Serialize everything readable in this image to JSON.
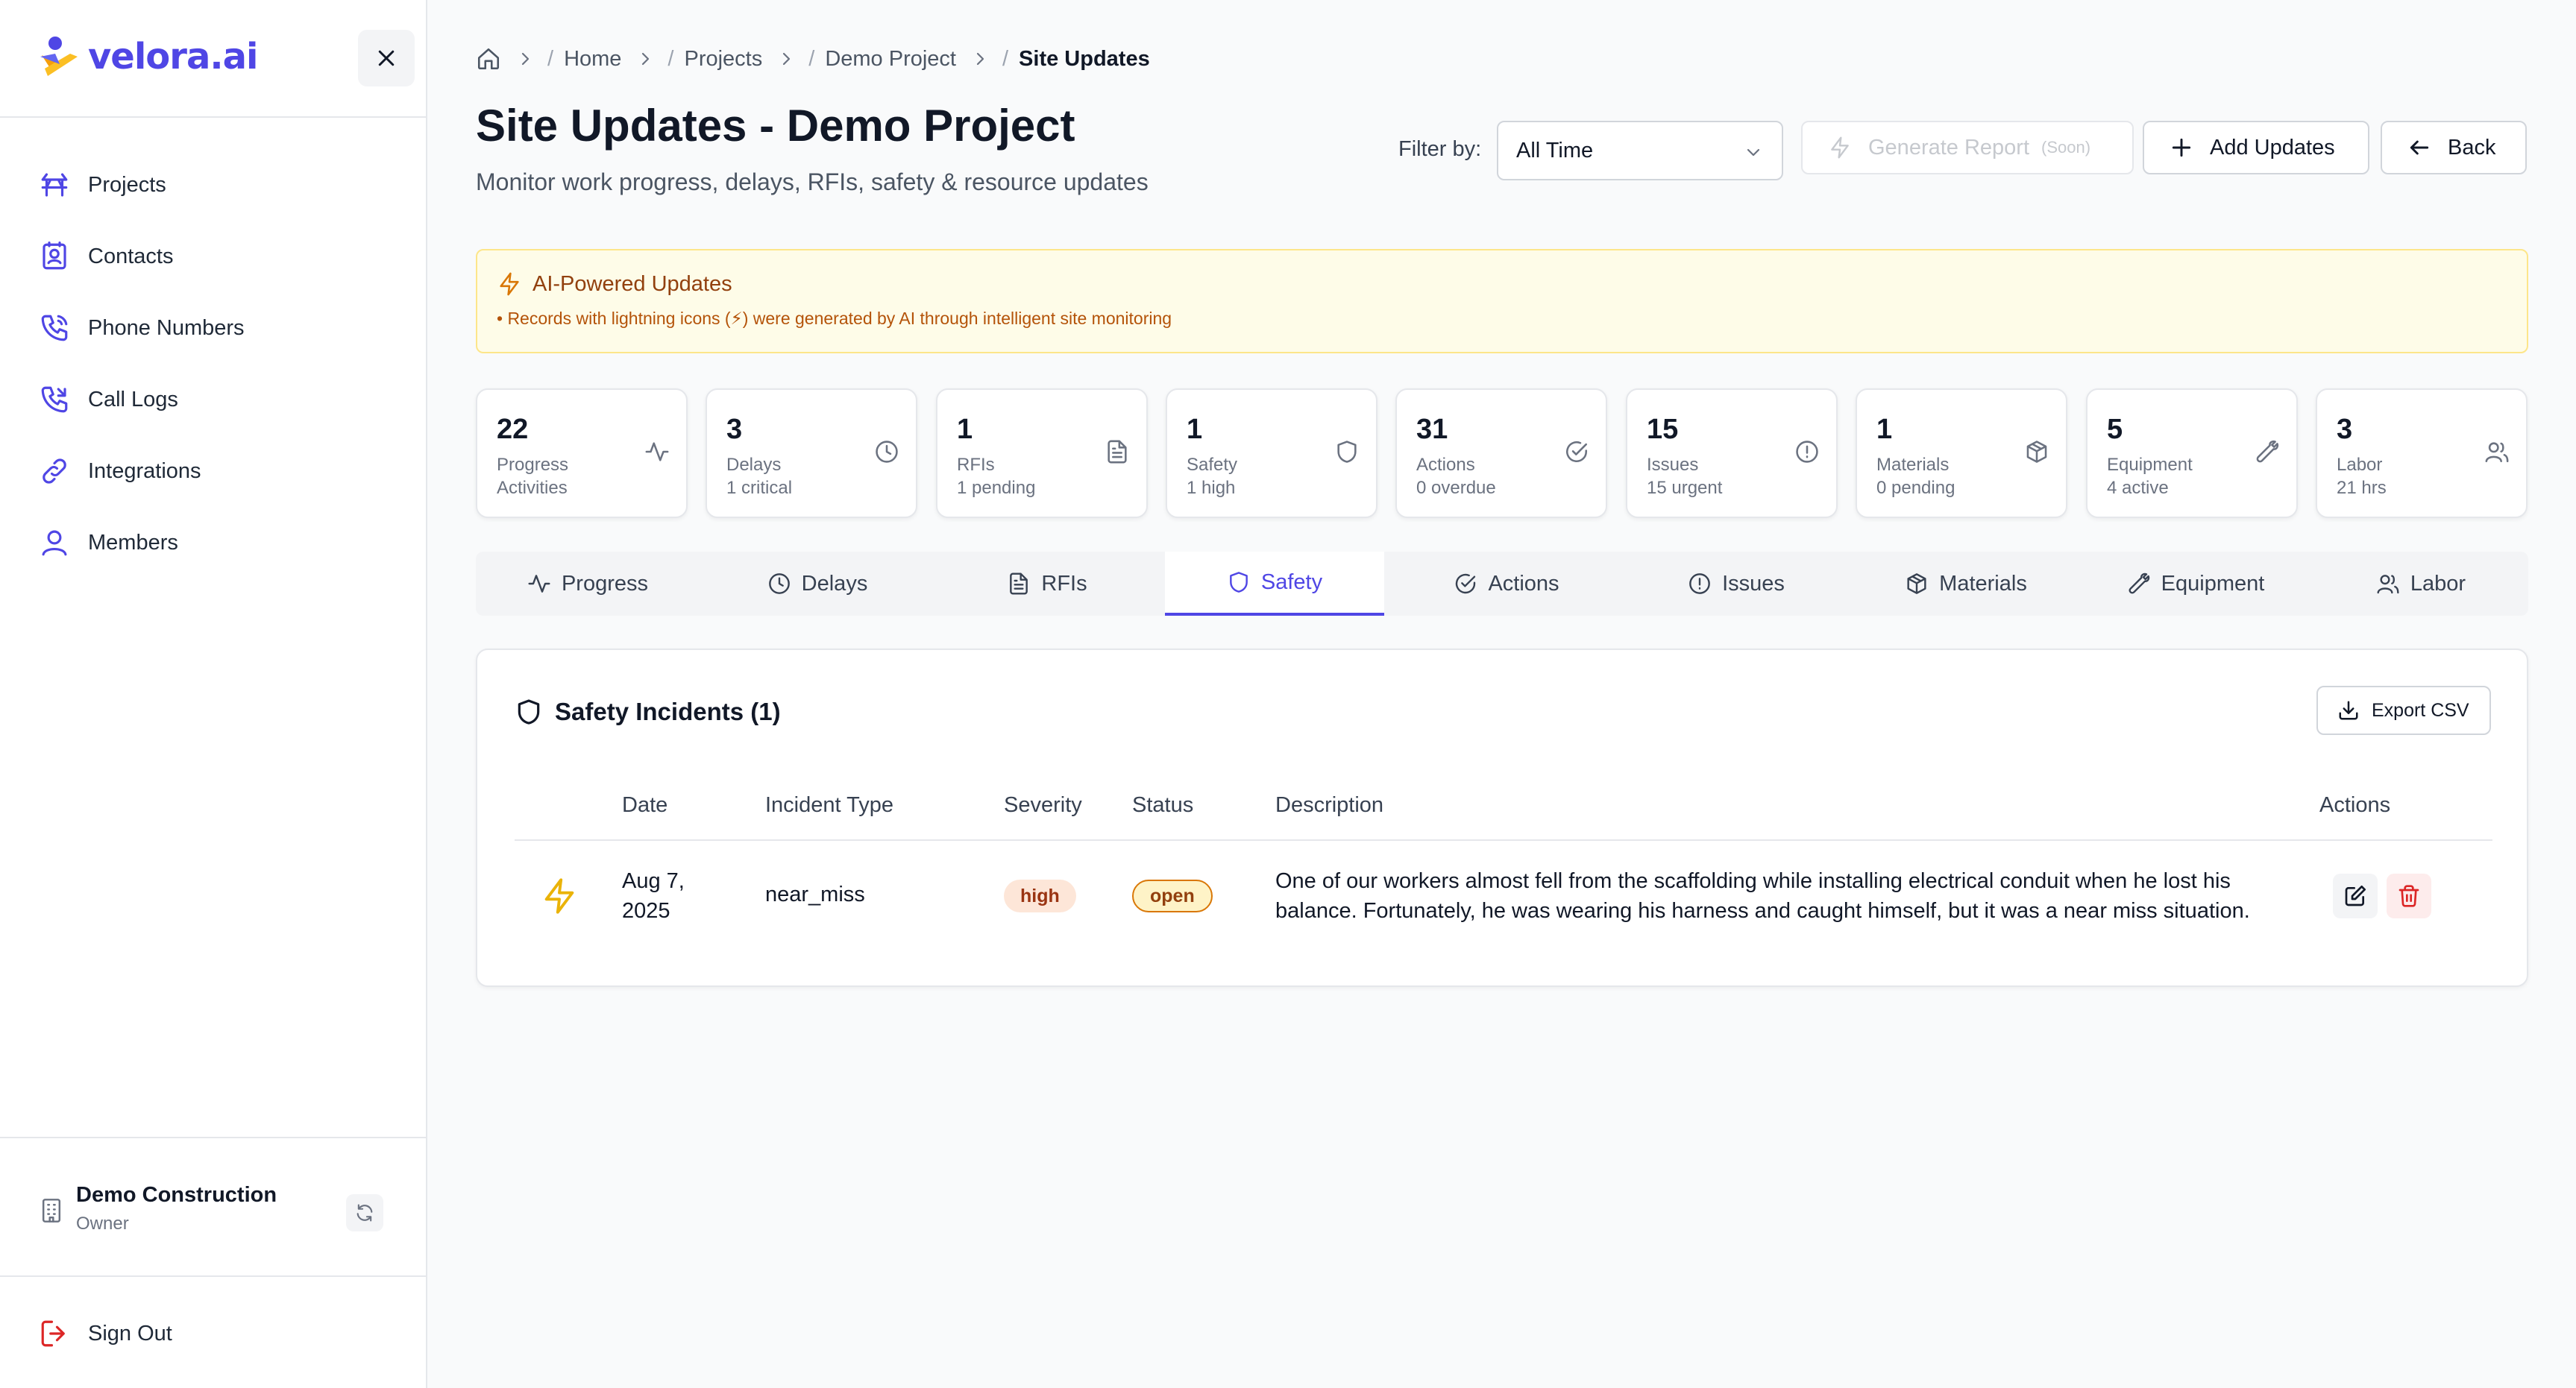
{
  "app": {
    "name": "velora.ai"
  },
  "sidebar": {
    "items": [
      {
        "label": "Projects",
        "icon": "projects-icon"
      },
      {
        "label": "Contacts",
        "icon": "contacts-icon"
      },
      {
        "label": "Phone Numbers",
        "icon": "phone-icon"
      },
      {
        "label": "Call Logs",
        "icon": "phone-call-icon"
      },
      {
        "label": "Integrations",
        "icon": "link-icon"
      },
      {
        "label": "Members",
        "icon": "user-icon"
      }
    ],
    "org": {
      "name": "Demo Construction",
      "role": "Owner"
    },
    "signout_label": "Sign Out"
  },
  "breadcrumb": {
    "items": [
      "Home",
      "Projects",
      "Demo Project"
    ],
    "current": "Site Updates"
  },
  "header": {
    "title": "Site Updates - Demo Project",
    "subtitle": "Monitor work progress, delays, RFIs, safety & resource updates",
    "filter_label": "Filter by:",
    "filter_value": "All Time",
    "generate_label": "Generate Report",
    "generate_soon": "(Soon)",
    "add_label": "Add Updates",
    "back_label": "Back"
  },
  "ai_banner": {
    "title": "AI-Powered Updates",
    "note": "• Records with lightning icons (⚡) were generated by AI through intelligent site monitoring"
  },
  "stats": [
    {
      "value": "22",
      "label": "Progress Activities",
      "sub": "",
      "icon": "activity-icon"
    },
    {
      "value": "3",
      "label": "Delays",
      "sub": "1 critical",
      "icon": "clock-icon"
    },
    {
      "value": "1",
      "label": "RFIs",
      "sub": "1 pending",
      "icon": "document-icon"
    },
    {
      "value": "1",
      "label": "Safety",
      "sub": "1 high",
      "icon": "shield-icon"
    },
    {
      "value": "31",
      "label": "Actions",
      "sub": "0 overdue",
      "icon": "check-circle-icon"
    },
    {
      "value": "15",
      "label": "Issues",
      "sub": "15 urgent",
      "icon": "alert-circle-icon"
    },
    {
      "value": "1",
      "label": "Materials",
      "sub": "0 pending",
      "icon": "package-icon"
    },
    {
      "value": "5",
      "label": "Equipment",
      "sub": "4 active",
      "icon": "wrench-icon"
    },
    {
      "value": "3",
      "label": "Labor",
      "sub": "21 hrs",
      "icon": "users-icon"
    }
  ],
  "tabs": [
    {
      "label": "Progress",
      "icon": "activity-icon",
      "active": false
    },
    {
      "label": "Delays",
      "icon": "clock-icon",
      "active": false
    },
    {
      "label": "RFIs",
      "icon": "document-icon",
      "active": false
    },
    {
      "label": "Safety",
      "icon": "shield-icon",
      "active": true
    },
    {
      "label": "Actions",
      "icon": "check-circle-icon",
      "active": false
    },
    {
      "label": "Issues",
      "icon": "alert-circle-icon",
      "active": false
    },
    {
      "label": "Materials",
      "icon": "package-icon",
      "active": false
    },
    {
      "label": "Equipment",
      "icon": "wrench-icon",
      "active": false
    },
    {
      "label": "Labor",
      "icon": "users-icon",
      "active": false
    }
  ],
  "table": {
    "title": "Safety Incidents (1)",
    "export_label": "Export CSV",
    "columns": [
      "Date",
      "Incident Type",
      "Severity",
      "Status",
      "Description",
      "Actions"
    ],
    "rows": [
      {
        "ai_generated": true,
        "date": "Aug 7, 2025",
        "type": "near_miss",
        "severity": "high",
        "status": "open",
        "description": "One of our workers almost fell from the scaffolding while installing electrical conduit when he lost his balance. Fortunately, he was wearing his harness and caught himself, but it was a near miss situation."
      }
    ]
  },
  "colors": {
    "accent": "#4f46e5",
    "ai_bolt": "#eab308",
    "danger": "#dc2626",
    "banner_bg": "#fefce8"
  }
}
